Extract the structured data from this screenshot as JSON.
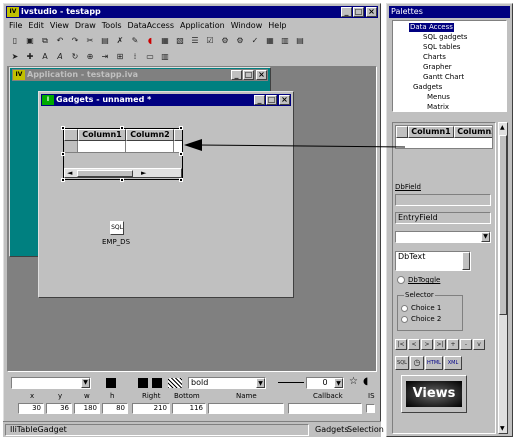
{
  "app": {
    "title": "ivstudio - testapp",
    "menus": [
      "File",
      "Edit",
      "View",
      "Draw",
      "Tools",
      "DataAccess",
      "Application",
      "Window",
      "Help"
    ]
  },
  "appwin": {
    "title": "Application - testapp.iva"
  },
  "gadgets": {
    "title": "Gadgets - unnamed *",
    "columns": [
      "Column1",
      "Column2"
    ],
    "emp": "EMP_DS"
  },
  "props": {
    "font": "bold",
    "zero": "0",
    "headers": [
      "x",
      "y",
      "w",
      "h",
      "Right",
      "Bottom",
      "Name",
      "Callback",
      "IS"
    ],
    "values": [
      "30",
      "36",
      "180",
      "80",
      "210",
      "116"
    ]
  },
  "status": {
    "left": "IliTableGadget",
    "gadgets": "Gadgets",
    "selection": "Selection"
  },
  "palettes": {
    "title": "Palettes",
    "tree": [
      "Data Access",
      "SQL gadgets",
      "SQL tables",
      "Charts",
      "Grapher",
      "Gantt Chart",
      "Gadgets",
      "Menus",
      "Matrix"
    ],
    "columns": [
      "Column1",
      "Column2"
    ],
    "dbfield": "DbField",
    "entryfield": "EntryField",
    "dbtext": "DbText",
    "dbtoggle": "DbToggle",
    "selector": "Selector",
    "choice1": "Choice 1",
    "choice2": "Choice 2",
    "nav": [
      "|<",
      "<",
      ">",
      ">|",
      "+",
      "-",
      "v"
    ],
    "views": "Views",
    "sql": "SQL",
    "html": "HTML",
    "xml": "XML"
  }
}
